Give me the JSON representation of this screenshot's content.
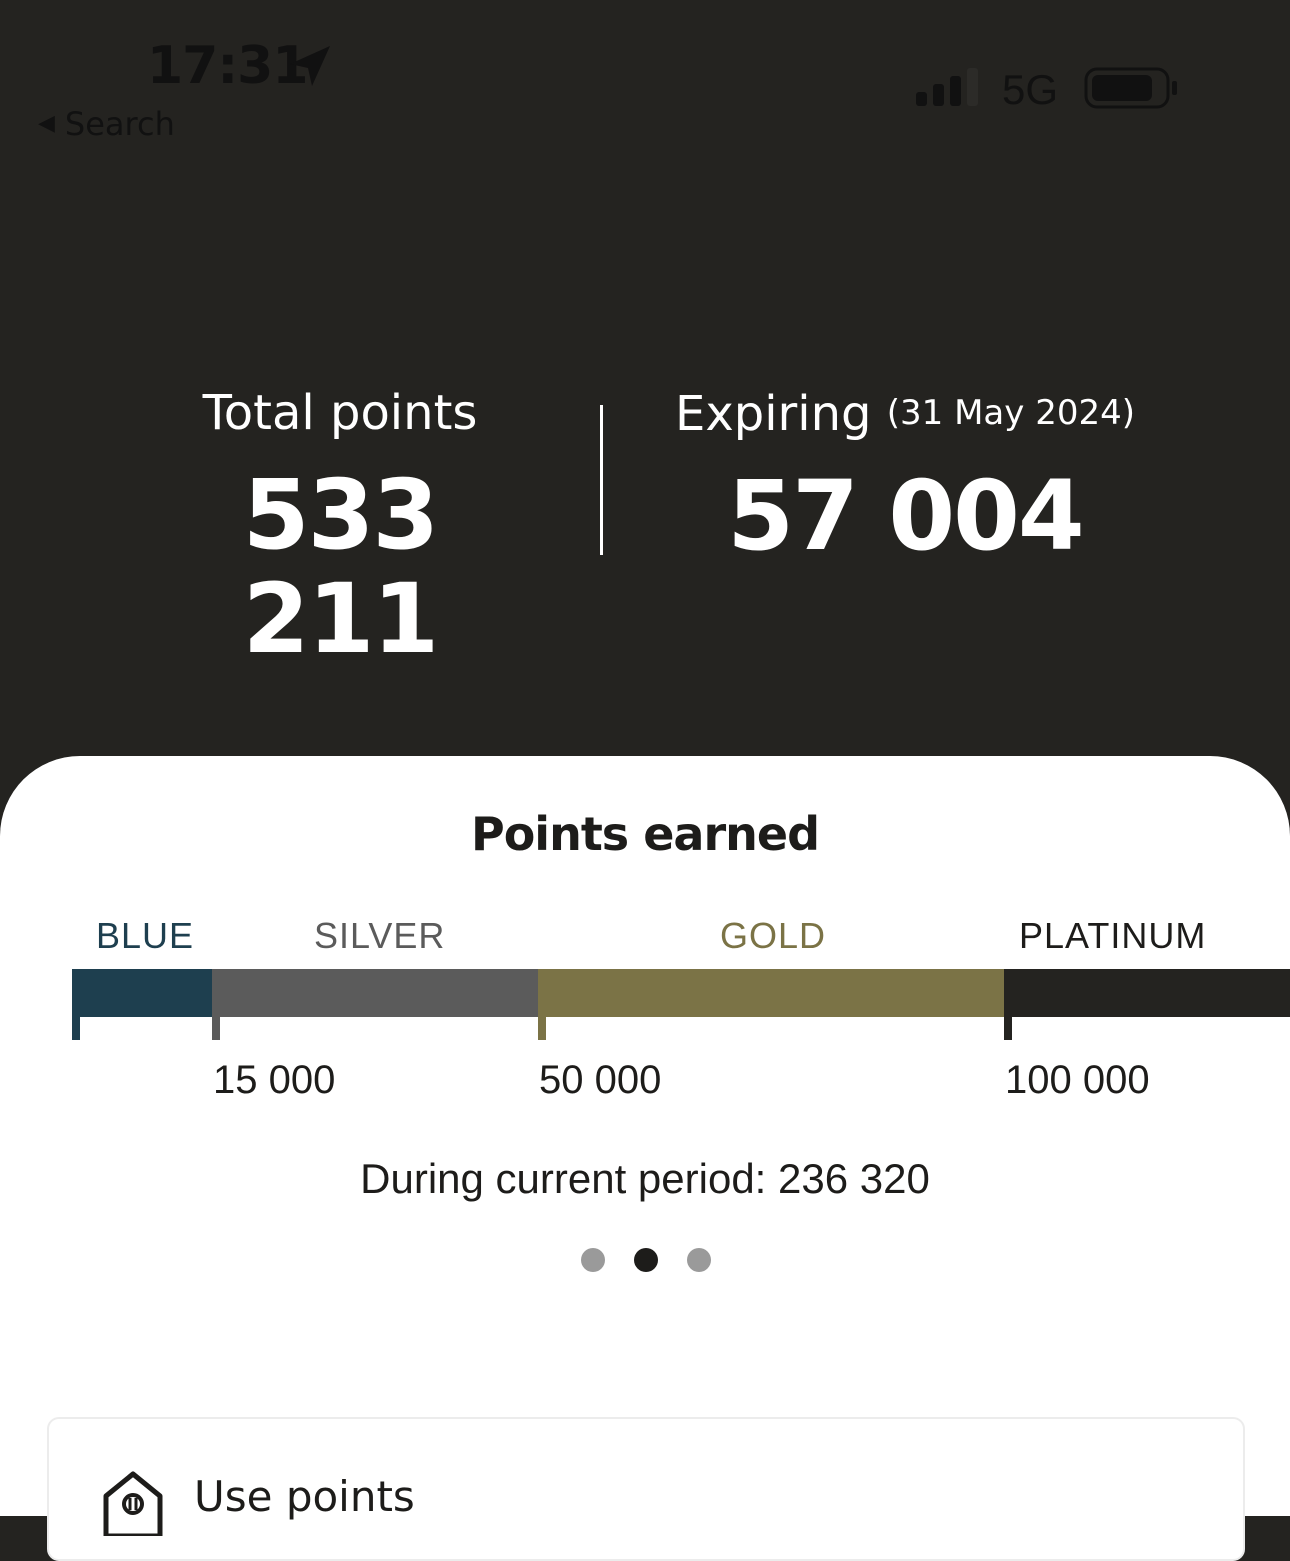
{
  "status_bar": {
    "time": "17:31",
    "back_label": "Search",
    "network": "5G",
    "icons": [
      "location-arrow-icon",
      "signal-bars-icon",
      "battery-icon"
    ]
  },
  "summary": {
    "total_label": "Total points",
    "total_value": "533 211",
    "expiring_label": "Expiring",
    "expiring_date": "(31 May 2024)",
    "expiring_value": "57 004"
  },
  "points_card": {
    "title": "Points earned",
    "tiers": [
      {
        "name": "BLUE",
        "color": "#1e3f4f"
      },
      {
        "name": "SILVER",
        "color": "#5b5b5b"
      },
      {
        "name": "GOLD",
        "color": "#7b7346"
      },
      {
        "name": "PLATINUM",
        "color": "#242320"
      }
    ],
    "thresholds": [
      "15 000",
      "50 000",
      "100 000"
    ],
    "period_text": "During current period: 236 320",
    "page_indicator": {
      "count": 3,
      "active_index": 1
    }
  },
  "use_points": {
    "label": "Use points",
    "icon": "tag-points-icon"
  },
  "colors": {
    "header_bg": "#242320",
    "card_bg": "#ffffff"
  }
}
